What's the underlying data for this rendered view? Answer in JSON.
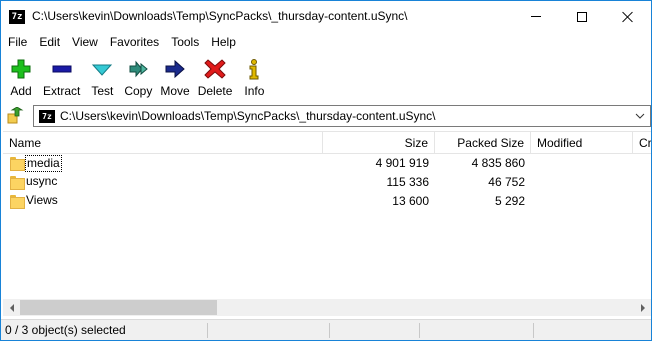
{
  "window": {
    "app_icon_text": "7z",
    "title": "C:\\Users\\kevin\\Downloads\\Temp\\SyncPacks\\_thursday-content.uSync\\"
  },
  "menu": {
    "items": [
      {
        "label": "File"
      },
      {
        "label": "Edit"
      },
      {
        "label": "View"
      },
      {
        "label": "Favorites"
      },
      {
        "label": "Tools"
      },
      {
        "label": "Help"
      }
    ]
  },
  "toolbar": {
    "add_label": "Add",
    "extract_label": "Extract",
    "test_label": "Test",
    "copy_label": "Copy",
    "move_label": "Move",
    "delete_label": "Delete",
    "info_label": "Info",
    "colors": {
      "add": "#1dbf1d",
      "extract": "#1a1aa6",
      "test": "#35c9d4",
      "copy": "#2e8b7a",
      "move": "#1a2a8c",
      "delete": "#e01b1b",
      "info": "#e0b800"
    }
  },
  "address": {
    "icon_text": "7z",
    "path": "C:\\Users\\kevin\\Downloads\\Temp\\SyncPacks\\_thursday-content.uSync\\"
  },
  "list": {
    "columns": {
      "name": "Name",
      "size": "Size",
      "packed": "Packed Size",
      "modified": "Modified",
      "created": "Cr"
    },
    "rows": [
      {
        "name": "media",
        "size": "4 901 919",
        "packed": "4 835 860",
        "icon": "folder-icon"
      },
      {
        "name": "usync",
        "size": "115 336",
        "packed": "46 752",
        "icon": "folder-icon"
      },
      {
        "name": "Views",
        "size": "13 600",
        "packed": "5 292",
        "icon": "folder-icon"
      }
    ]
  },
  "status": {
    "selection": "0 / 3 object(s) selected"
  }
}
